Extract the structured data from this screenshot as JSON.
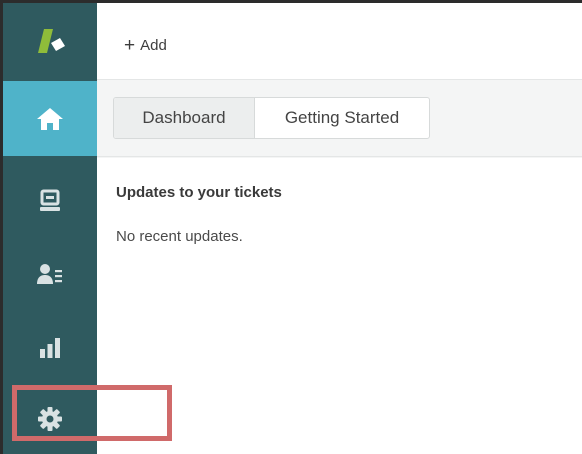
{
  "sidebar": {
    "items": [
      {
        "name": "logo",
        "icon": "zendesk-logo-icon"
      },
      {
        "name": "home",
        "icon": "home-icon",
        "active": true
      },
      {
        "name": "tickets",
        "icon": "tickets-icon"
      },
      {
        "name": "customers",
        "icon": "customers-icon"
      },
      {
        "name": "reports",
        "icon": "reports-icon"
      },
      {
        "name": "admin",
        "icon": "gear-icon"
      }
    ]
  },
  "toolbar": {
    "add_label": "Add"
  },
  "tabs": [
    {
      "label": "Dashboard",
      "selected": true
    },
    {
      "label": "Getting Started",
      "selected": false
    }
  ],
  "main": {
    "updates_title": "Updates to your tickets",
    "updates_empty": "No recent updates."
  },
  "colors": {
    "sidebar_bg": "#2f5a5f",
    "sidebar_active": "#4fb3c9",
    "logo_green": "#8fbc3a",
    "highlight": "#d06a6a"
  }
}
